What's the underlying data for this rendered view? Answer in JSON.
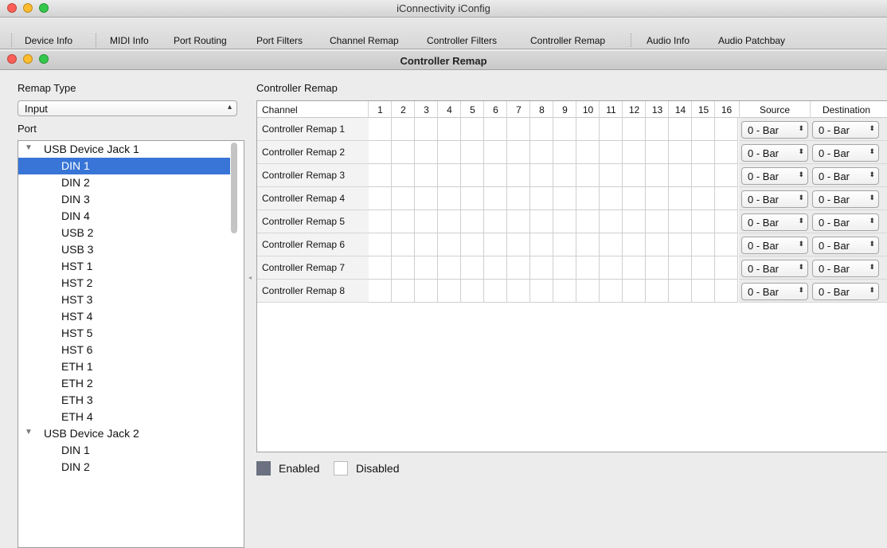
{
  "window": {
    "title": "iConnectivity iConfig",
    "subtitle": "Controller Remap"
  },
  "toolbar": {
    "tabs": [
      "Device Info",
      "MIDI Info",
      "Port Routing",
      "Port Filters",
      "Channel Remap",
      "Controller Filters",
      "Controller Remap",
      "Audio Info",
      "Audio Patchbay"
    ]
  },
  "left": {
    "remap_type_label": "Remap Type",
    "remap_type_value": "Input",
    "port_label": "Port",
    "tree": [
      {
        "label": "USB Device Jack 1",
        "group": true
      },
      {
        "label": "DIN 1",
        "selected": true
      },
      {
        "label": "DIN 2"
      },
      {
        "label": "DIN 3"
      },
      {
        "label": "DIN 4"
      },
      {
        "label": "USB 2"
      },
      {
        "label": "USB 3"
      },
      {
        "label": "HST 1"
      },
      {
        "label": "HST 2"
      },
      {
        "label": "HST 3"
      },
      {
        "label": "HST 4"
      },
      {
        "label": "HST 5"
      },
      {
        "label": "HST 6"
      },
      {
        "label": "ETH 1"
      },
      {
        "label": "ETH 2"
      },
      {
        "label": "ETH 3"
      },
      {
        "label": "ETH 4"
      },
      {
        "label": "USB Device Jack 2",
        "group": true
      },
      {
        "label": "DIN 1"
      },
      {
        "label": "DIN 2"
      }
    ]
  },
  "grid": {
    "section_title": "Controller Remap",
    "channel_header": "Channel",
    "channels": [
      "1",
      "2",
      "3",
      "4",
      "5",
      "6",
      "7",
      "8",
      "9",
      "10",
      "11",
      "12",
      "13",
      "14",
      "15",
      "16"
    ],
    "source_header": "Source",
    "destination_header": "Destination",
    "rows": [
      {
        "label": "Controller Remap 1",
        "source": "0 - Bar",
        "destination": "0 - Bar"
      },
      {
        "label": "Controller Remap 2",
        "source": "0 - Bar",
        "destination": "0 - Bar"
      },
      {
        "label": "Controller Remap 3",
        "source": "0 - Bar",
        "destination": "0 - Bar"
      },
      {
        "label": "Controller Remap 4",
        "source": "0 - Bar",
        "destination": "0 - Bar"
      },
      {
        "label": "Controller Remap 5",
        "source": "0 - Bar",
        "destination": "0 - Bar"
      },
      {
        "label": "Controller Remap 6",
        "source": "0 - Bar",
        "destination": "0 - Bar"
      },
      {
        "label": "Controller Remap 7",
        "source": "0 - Bar",
        "destination": "0 - Bar"
      },
      {
        "label": "Controller Remap 8",
        "source": "0 - Bar",
        "destination": "0 - Bar"
      }
    ]
  },
  "legend": {
    "enabled_label": "Enabled",
    "disabled_label": "Disabled",
    "enabled_color": "#6b7180",
    "disabled_color": "#ffffff"
  },
  "colors": {
    "close": "#fc5f57",
    "minimize": "#fdbc2e",
    "zoom": "#34c84a",
    "selection": "#3875d7"
  }
}
